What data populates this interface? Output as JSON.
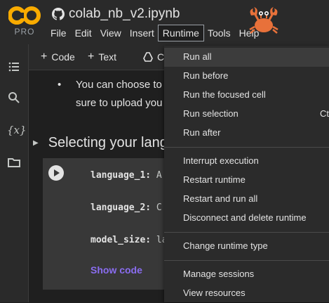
{
  "app": {
    "logo_text": "CO",
    "badge": "PRO",
    "notebook_title": "colab_nb_v2.ipynb",
    "brand_colors": {
      "logo_orange": "#f9ab00",
      "crab": "#e8713a"
    }
  },
  "menu": {
    "items": [
      "File",
      "Edit",
      "View",
      "Insert",
      "Runtime",
      "Tools",
      "Help"
    ],
    "active": "Runtime"
  },
  "sidebar": {
    "icons": [
      "table-of-contents-icon",
      "search-icon",
      "variables-icon",
      "files-icon"
    ]
  },
  "toolbar": {
    "add_code": "Code",
    "add_text": "Text",
    "copy_label": "C"
  },
  "content": {
    "bullet_line1": "You can choose to",
    "bullet_line2": "sure to upload you",
    "section_title": "Selecting your lang",
    "params": [
      {
        "name": "language_1:",
        "value": "A"
      },
      {
        "name": "language_2:",
        "value": "C"
      },
      {
        "name": "model_size:",
        "value": "la"
      }
    ],
    "show_code": "Show code"
  },
  "runtime_menu": {
    "items": [
      {
        "label": "Run all",
        "hover": true
      },
      {
        "label": "Run before"
      },
      {
        "label": "Run the focused cell"
      },
      {
        "label": "Run selection",
        "shortcut": "Ct"
      },
      {
        "label": "Run after"
      },
      {
        "label": "Interrupt execution"
      },
      {
        "label": "Restart runtime"
      },
      {
        "label": "Restart and run all"
      },
      {
        "label": "Disconnect and delete runtime"
      },
      {
        "label": "Change runtime type"
      },
      {
        "label": "Manage sessions"
      },
      {
        "label": "View resources"
      }
    ]
  }
}
